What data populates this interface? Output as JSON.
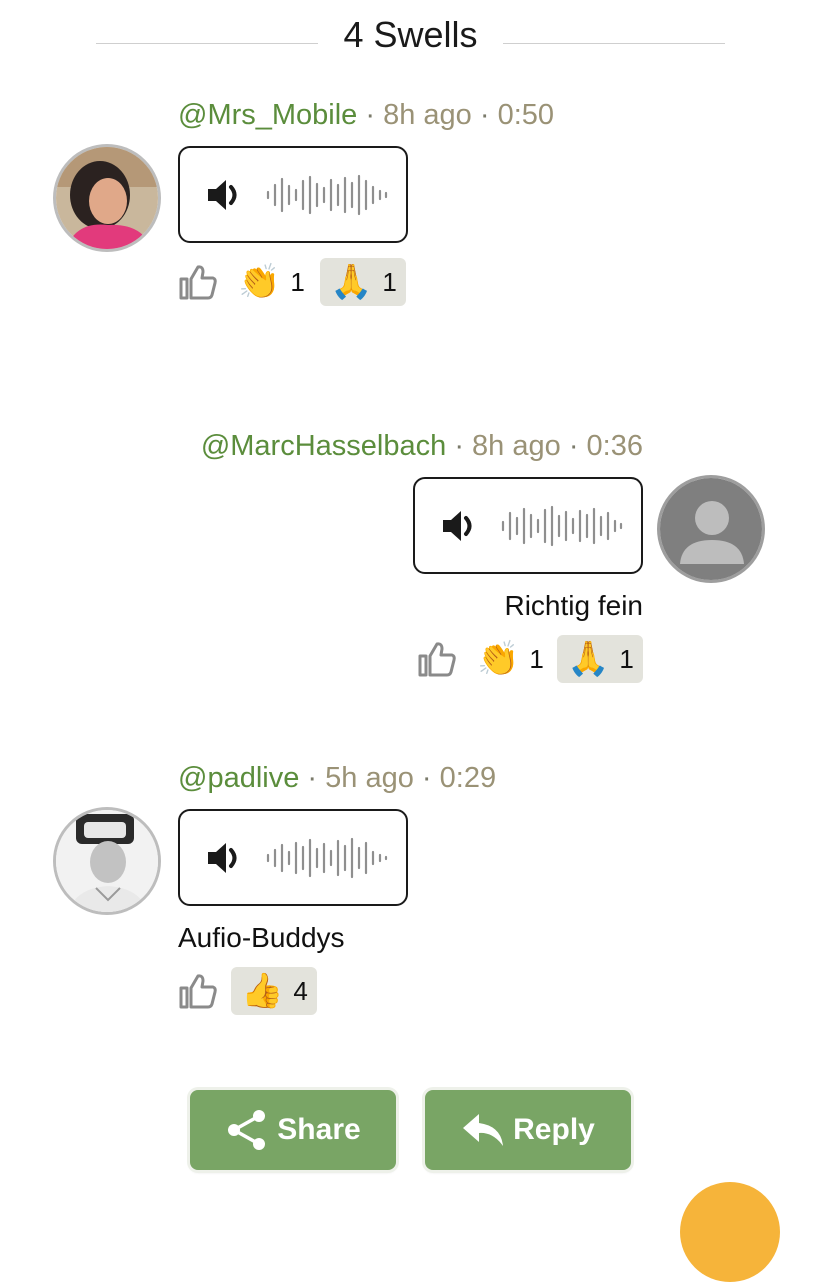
{
  "header": {
    "title": "4 Swells"
  },
  "separator": "·",
  "swells": [
    {
      "user": "@Mrs_Mobile",
      "age": "8h ago",
      "duration": "0:50",
      "caption": "",
      "reactions": [
        {
          "emoji": "👏",
          "count": "1"
        },
        {
          "emoji": "🙏",
          "count": "1"
        }
      ]
    },
    {
      "user": "@MarcHasselbach",
      "age": "8h ago",
      "duration": "0:36",
      "caption": "Richtig fein",
      "reactions": [
        {
          "emoji": "👏",
          "count": "1"
        },
        {
          "emoji": "🙏",
          "count": "1"
        }
      ]
    },
    {
      "user": "@padlive",
      "age": "5h ago",
      "duration": "0:29",
      "caption": "Aufio-Buddys",
      "reactions": [
        {
          "emoji": "👍",
          "count": "4"
        }
      ]
    }
  ],
  "actions": {
    "share": "Share",
    "reply": "Reply"
  },
  "icons": {
    "speaker": "speaker-icon",
    "waveform": "waveform-icon",
    "like": "thumbs-up-outline-icon",
    "share": "share-icon",
    "reply": "reply-arrow-icon"
  },
  "colors": {
    "accent": "#79a565",
    "username": "#5b8d3c",
    "meta": "#9a9276",
    "chip": "#e3e3dc",
    "fab": "#f6b43a"
  }
}
